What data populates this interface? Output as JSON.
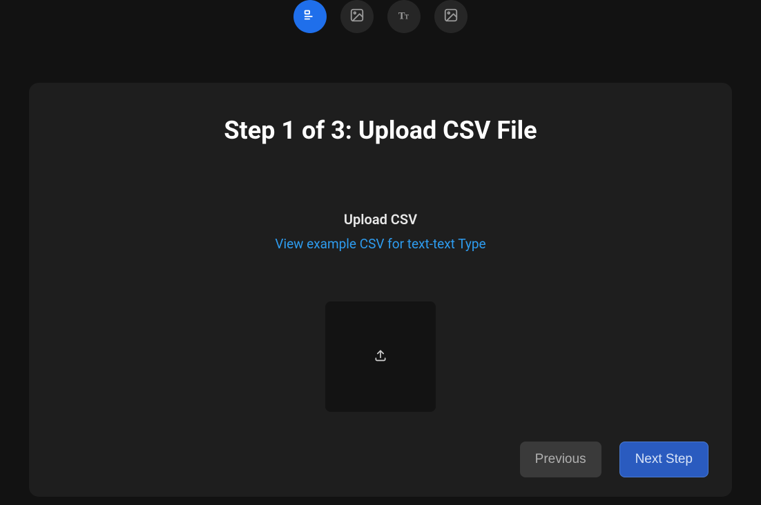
{
  "tabs": {
    "items": [
      {
        "name": "text-text-tab",
        "icon": "text-text-icon",
        "active": true
      },
      {
        "name": "image-tab-1",
        "icon": "image-icon",
        "active": false
      },
      {
        "name": "font-tab",
        "icon": "font-icon",
        "active": false
      },
      {
        "name": "image-tab-2",
        "icon": "image-icon",
        "active": false
      }
    ]
  },
  "step": {
    "title": "Step 1 of 3: Upload CSV File"
  },
  "upload": {
    "label": "Upload CSV",
    "example_link": "View example CSV for text-text Type"
  },
  "buttons": {
    "previous": "Previous",
    "next": "Next Step"
  }
}
